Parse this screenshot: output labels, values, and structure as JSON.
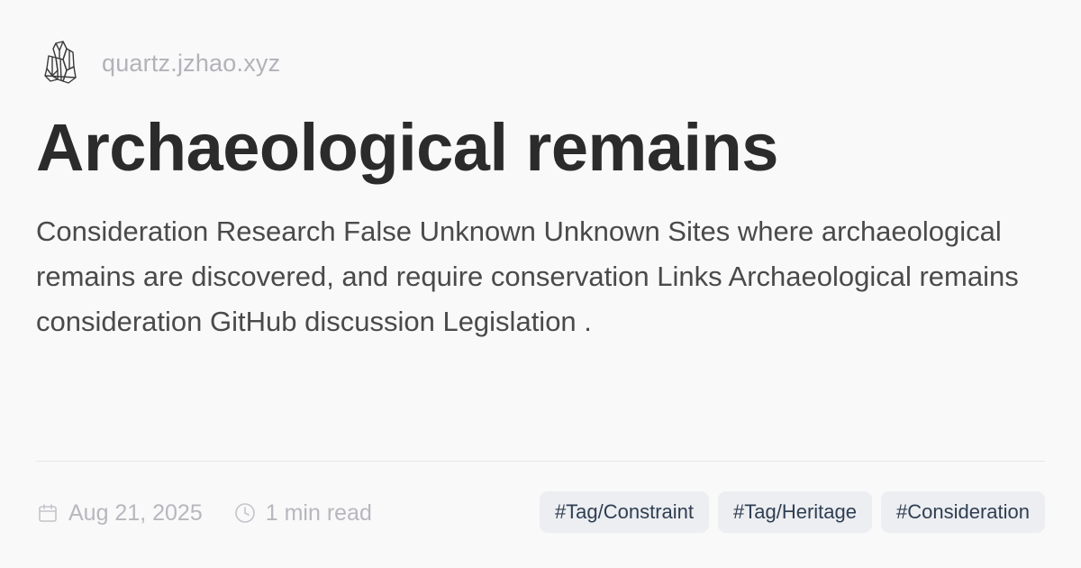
{
  "site": {
    "logo_icon": "crystal-logo-icon",
    "domain": "quartz.jzhao.xyz"
  },
  "page": {
    "title": "Archaeological remains",
    "description": "Consideration Research False Unknown Unknown Sites where archaeological remains are discovered, and require conservation Links Archaeological remains consideration GitHub discussion Legislation ."
  },
  "meta": {
    "date_icon": "calendar-icon",
    "date": "Aug 21, 2025",
    "reading_icon": "clock-icon",
    "reading_time": "1 min read"
  },
  "tags": [
    "#Tag/Constraint",
    "#Tag/Heritage",
    "#Consideration"
  ],
  "colors": {
    "background": "#f9f9fa",
    "title": "#2b2b2b",
    "body_text": "#4a4a4a",
    "muted": "#b7b7bd",
    "tag_background": "#eceef1",
    "tag_text": "#2f3e52"
  }
}
